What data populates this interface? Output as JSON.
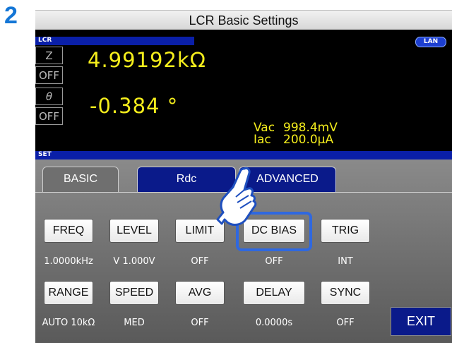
{
  "step_number": "2",
  "title": "LCR Basic Settings",
  "screen": {
    "mode_label": "LCR",
    "lan_label": "LAN",
    "set_label": "SET",
    "params": [
      "Z",
      "OFF",
      "θ",
      "OFF"
    ],
    "primary_value": "4.99192kΩ",
    "secondary_value": "-0.384 °",
    "monitor": {
      "vac_label": "Vac",
      "vac_value": "998.4mV",
      "iac_label": "Iac",
      "iac_value": "200.0μA"
    }
  },
  "tabs": [
    {
      "label": "BASIC",
      "active": true
    },
    {
      "label": "Rdc",
      "active": false
    },
    {
      "label": "ADVANCED",
      "active": false
    }
  ],
  "buttons_row1": [
    {
      "label": "FREQ",
      "value": "1.0000kHz"
    },
    {
      "label": "LEVEL",
      "value": "V 1.000V"
    },
    {
      "label": "LIMIT",
      "value": "OFF"
    },
    {
      "label": "DC BIAS",
      "value": "OFF"
    },
    {
      "label": "TRIG",
      "value": "INT"
    }
  ],
  "buttons_row2": [
    {
      "label": "RANGE",
      "value": "AUTO  10kΩ"
    },
    {
      "label": "SPEED",
      "value": "MED"
    },
    {
      "label": "AVG",
      "value": "OFF"
    },
    {
      "label": "DELAY",
      "value": "0.0000s"
    },
    {
      "label": "SYNC",
      "value": "OFF"
    }
  ],
  "exit_label": "EXIT",
  "colors": {
    "accent_blue": "#1476d6",
    "display_yellow": "#f5ee1c",
    "header_blue": "#0a1fa8",
    "highlight_blue": "#2f68e0"
  }
}
